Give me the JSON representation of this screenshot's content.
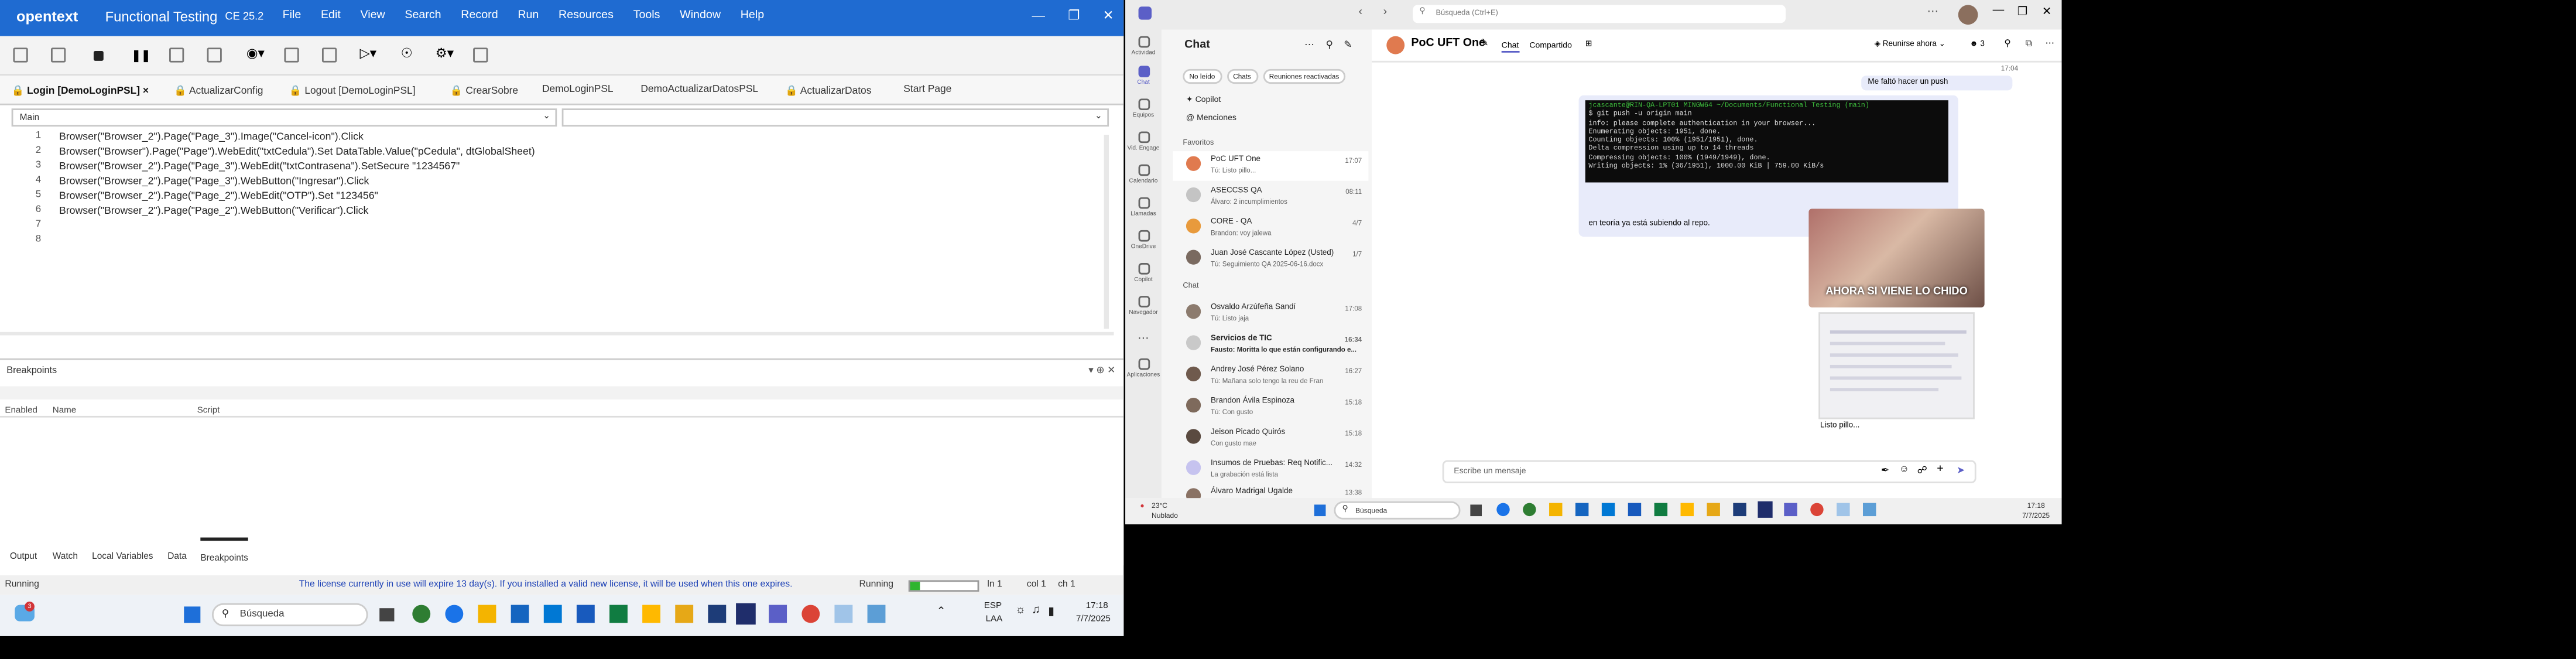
{
  "uft": {
    "logo": "opentext",
    "app_name": "Functional Testing",
    "version": "CE 25.2",
    "menu": [
      "File",
      "Edit",
      "View",
      "Search",
      "Record",
      "Run",
      "Resources",
      "Tools",
      "Window",
      "Help"
    ],
    "tabs": [
      "Login [DemoLoginPSL]",
      "ActualizarConfig",
      "Logout [DemoLoginPSL]",
      "CrearSobre",
      "DemoLoginPSL",
      "DemoActualizarDatosPSL",
      "ActualizarDatos",
      "Start Page"
    ],
    "combo_left": "Main",
    "code_lines": [
      "Browser(\"Browser_2\").Page(\"Page_3\").Image(\"Cancel-icon\").Click",
      "Browser(\"Browser\").Page(\"Page\").WebEdit(\"txtCedula\").Set DataTable.Value(\"pCedula\", dtGlobalSheet)",
      "Browser(\"Browser_2\").Page(\"Page_3\").WebEdit(\"txtContrasena\").SetSecure \"1234567\"",
      "Browser(\"Browser_2\").Page(\"Page_3\").WebButton(\"Ingresar\").Click",
      "Browser(\"Browser_2\").Page(\"Page_2\").WebEdit(\"OTP\").Set \"123456\"",
      "Browser(\"Browser_2\").Page(\"Page_2\").WebButton(\"Verificar\").Click",
      "",
      ""
    ],
    "breakpoints_title": "Breakpoints",
    "bp_columns": [
      "Enabled",
      "Name",
      "Script"
    ],
    "bottom_tabs": [
      "Output",
      "Watch",
      "Local Variables",
      "Data",
      "Breakpoints"
    ],
    "status_left": "Running",
    "status_license": "The license currently in use will expire 13 day(s). If you installed a valid new license, it will be used when this one expires.",
    "status_running": "Running",
    "status_ln": "ln 1",
    "status_col": "col 1",
    "status_ch": "ch 1"
  },
  "taskbar_left": {
    "search": "Búsqueda",
    "lang": "ESP",
    "lang2": "LAA",
    "time": "17:18",
    "date": "7/7/2025",
    "badge": "3"
  },
  "teams": {
    "search": "Búsqueda (Ctrl+E)",
    "list_title": "Chat",
    "filters": [
      "No leído",
      "Chats",
      "Reuniones reactivadas"
    ],
    "copilot": "Copilot",
    "mentions": "Menciones",
    "favorites_label": "Favoritos",
    "chat_label": "Chat",
    "rail": [
      "Actividad",
      "Chat",
      "Equipos",
      "Vid. Engage",
      "Calendario",
      "Llamadas",
      "OneDrive",
      "Copilot",
      "Navegador",
      "Aplicaciones"
    ],
    "favorites": [
      {
        "name": "PoC UFT One",
        "preview": "Tú: Listo pillo...",
        "time": "17:07"
      },
      {
        "name": "ASECCSS QA",
        "preview": "Álvaro: 2 incumplimientos",
        "time": "08:11"
      },
      {
        "name": "CORE - QA",
        "preview": "Brandon: voy jalewa",
        "time": "4/7"
      },
      {
        "name": "Juan José Cascante López (Usted)",
        "preview": "Tú: Seguimiento QA 2025-06-16.docx",
        "time": "1/7"
      }
    ],
    "chats": [
      {
        "name": "Osvaldo Arzúfeña Sandí",
        "preview": "Tú: Listo jaja",
        "time": "17:08"
      },
      {
        "name": "Servicios de TIC",
        "preview": "Fausto: Moritta lo que están configurando e...",
        "time": "16:34"
      },
      {
        "name": "Andrey José Pérez Solano",
        "preview": "Tú: Mañana solo tengo la reu de Fran",
        "time": "16:27"
      },
      {
        "name": "Brandon Ávila Espinoza",
        "preview": "Tú: Con gusto",
        "time": "15:18"
      },
      {
        "name": "Jeison Picado Quirós",
        "preview": "Con gusto mae",
        "time": "15:18"
      },
      {
        "name": "Insumos de Pruebas: Req Notific...",
        "preview": "La grabación está lista",
        "time": "14:32"
      },
      {
        "name": "Álvaro Madrigal Ugalde",
        "preview": "",
        "time": "13:38"
      }
    ],
    "chat_title": "PoC UFT One",
    "chat_tabs": [
      "Chat",
      "Compartido"
    ],
    "meet": "Reunirse ahora",
    "people_count": "3",
    "msg_time": "17:04",
    "msg1": "Me faltó hacer un push",
    "terminal": [
      "jcascante@RIN-QA-LPT01 MINGW64 ~/Documents/Functional Testing (main)",
      "$ git push -u origin main",
      "info: please complete authentication in your browser...",
      "Enumerating objects: 1951, done.",
      "Counting objects: 100% (1951/1951), done.",
      "Delta compression using up to 14 threads",
      "Compressing objects: 100% (1949/1949), done.",
      "Writing objects:   1% (36/1951), 1000.00 KiB | 759.00 KiB/s"
    ],
    "msg2": "en teoría ya está subiendo al repo.",
    "meme_caption": "AHORA SI VIENE LO CHIDO",
    "msg3": "Listo pillo...",
    "compose": "Escribe un mensaje",
    "weather_temp": "23°C",
    "weather_desc": "Nublado",
    "tb_search": "Búsqueda",
    "tb_time": "17:18",
    "tb_date": "7/7/2025"
  }
}
